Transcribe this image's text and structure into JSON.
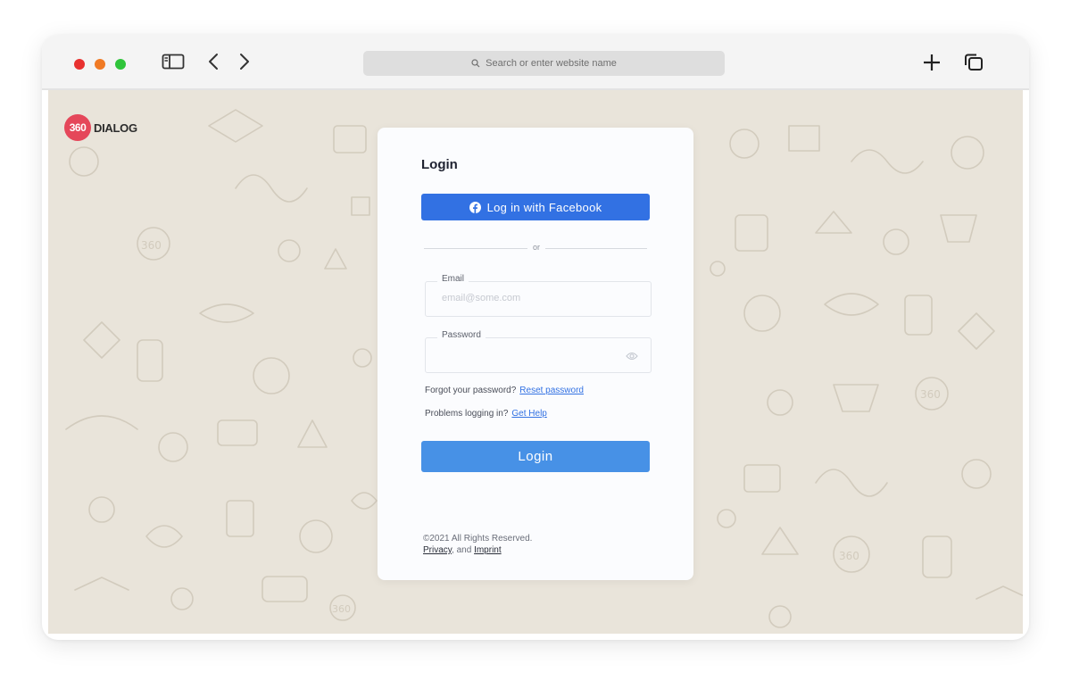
{
  "browser": {
    "search_placeholder": "Search or enter website name",
    "icons": [
      "sidebar-icon",
      "back-icon",
      "forward-icon",
      "new-tab-icon",
      "tabs-overview-icon",
      "search-icon"
    ],
    "traffic_colors": [
      "#e8312f",
      "#f07a24",
      "#2fc43a"
    ]
  },
  "brand": {
    "logo_mark": "360",
    "logo_text": "DIALOG",
    "accent": "#e5475a"
  },
  "login": {
    "title": "Login",
    "facebook_label": "Log in with Facebook",
    "divider": "or",
    "email_label": "Email",
    "email_placeholder": "email@some.com",
    "email_value": "",
    "password_label": "Password",
    "password_value": "",
    "forgot_text": "Forgot your password?",
    "reset_link": "Reset password",
    "problems_text": "Problems logging in?",
    "help_link": "Get Help",
    "submit_label": "Login",
    "facebook_color": "#3271e3",
    "submit_color": "#4791e6"
  },
  "footer": {
    "copyright": "©2021 All Rights Reserved.",
    "privacy": "Privacy",
    "and_text": ", and ",
    "imprint": "Imprint"
  }
}
